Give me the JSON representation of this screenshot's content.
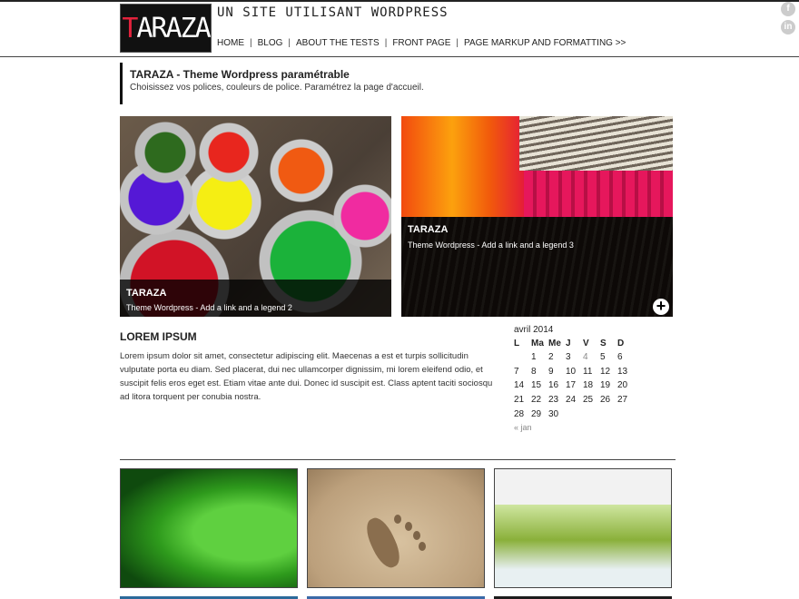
{
  "header": {
    "logo_text": "TARAZA",
    "site_title": "UN SITE UTILISANT WORDPRESS",
    "nav": [
      "HOME",
      "BLOG",
      "ABOUT THE TESTS",
      "FRONT PAGE",
      "PAGE MARKUP AND FORMATTING >>"
    ],
    "social": [
      {
        "icon": "facebook-icon",
        "glyph": "f"
      },
      {
        "icon": "linkedin-icon",
        "glyph": "in"
      }
    ]
  },
  "intro": {
    "title": "TARAZA - Theme Wordpress paramétrable",
    "subtitle": "Choisissez vos polices, couleurs de police. Paramétrez la page d'accueil."
  },
  "slides": [
    {
      "title": "TARAZA",
      "subtitle": "Theme Wordpress - Add a link and a legend 2"
    },
    {
      "title": "TARAZA",
      "subtitle": "Theme Wordpress - Add a link and a legend 3",
      "more_glyph": "+"
    }
  ],
  "article": {
    "title": "LOREM IPSUM",
    "body": "Lorem ipsum dolor sit amet, consectetur adipiscing elit. Maecenas a est et turpis sollicitudin vulputate porta eu diam. Sed placerat, dui nec ullamcorper dignissim, mi lorem eleifend odio, et suscipit felis eros eget est. Etiam vitae ante dui. Donec id suscipit est. Class aptent taciti sociosqu ad litora torquent per conubia nostra."
  },
  "calendar": {
    "caption": "avril 2014",
    "days": [
      "L",
      "Ma",
      "Me",
      "J",
      "V",
      "S",
      "D"
    ],
    "weeks": [
      [
        "",
        "1",
        "2",
        "3",
        "4",
        "5",
        "6"
      ],
      [
        "7",
        "8",
        "9",
        "10",
        "11",
        "12",
        "13"
      ],
      [
        "14",
        "15",
        "16",
        "17",
        "18",
        "19",
        "20"
      ],
      [
        "21",
        "22",
        "23",
        "24",
        "25",
        "26",
        "27"
      ],
      [
        "28",
        "29",
        "30",
        "",
        "",
        "",
        ""
      ]
    ],
    "prev_link": "« jan",
    "colors": {
      "muted": "#888888"
    }
  },
  "colors": {
    "logo_accent": "#e2223c",
    "text": "#222222"
  }
}
